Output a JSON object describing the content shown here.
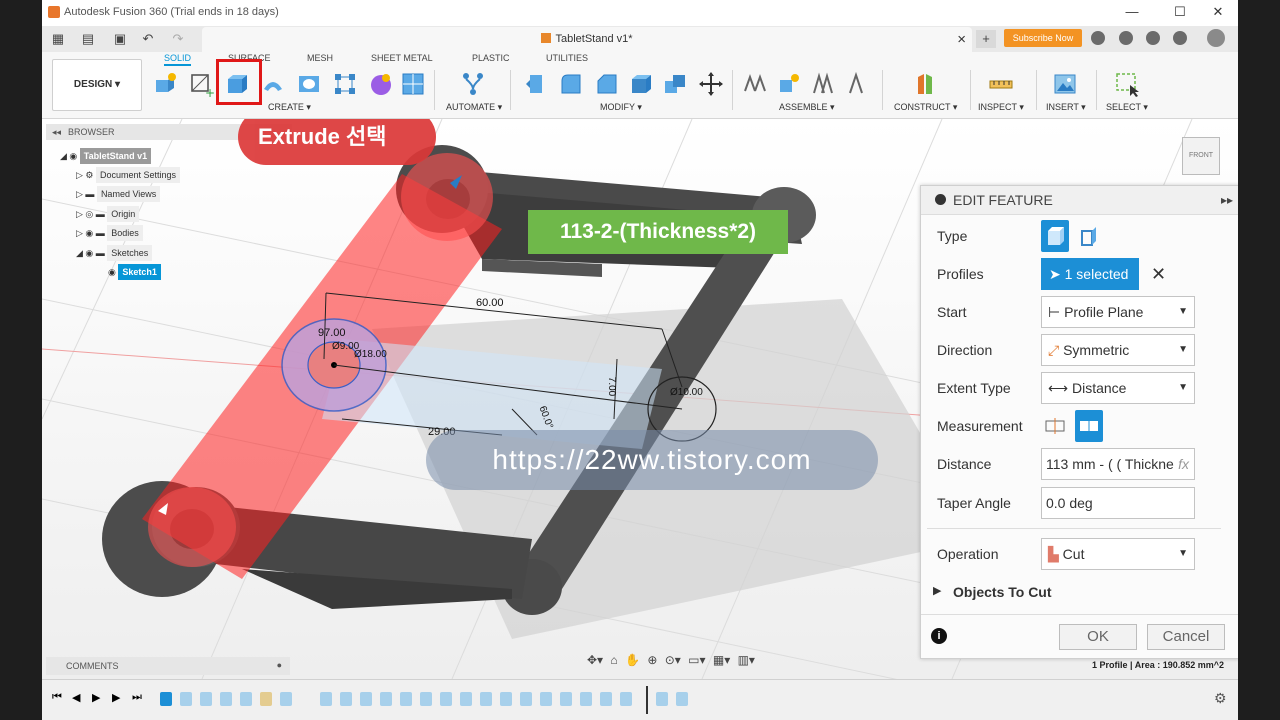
{
  "window": {
    "title": "Autodesk Fusion 360 (Trial ends in 18 days)",
    "minimize": "—",
    "maximize": "☐",
    "close": "✕"
  },
  "tabbar": {
    "doc_tab": "TabletStand v1*",
    "doc_close": "×",
    "new_tab": "+",
    "subscribe": "Subscribe Now"
  },
  "toolbar": {
    "workspace": "DESIGN ▾",
    "tabs": [
      "SOLID",
      "SURFACE",
      "MESH",
      "SHEET METAL",
      "PLASTIC",
      "UTILITIES"
    ],
    "groups": [
      "CREATE ▾",
      "AUTOMATE ▾",
      "MODIFY ▾",
      "ASSEMBLE ▾",
      "CONSTRUCT ▾",
      "INSPECT ▾",
      "INSERT ▾",
      "SELECT ▾"
    ]
  },
  "browser": {
    "title": "BROWSER",
    "items": [
      "TabletStand v1",
      "Document Settings",
      "Named Views",
      "Origin",
      "Bodies",
      "Sketches",
      "Sketch1"
    ]
  },
  "annotations": {
    "extrude": "Extrude 선택",
    "formula": "113-2-(Thickness*2)",
    "watermark": "https://22ww.tistory.com"
  },
  "dimensions": [
    "60.00",
    "97.00",
    "Ø9.00",
    "Ø18.00",
    "7.00",
    "29.00",
    "60.0°",
    "Ø10.00"
  ],
  "edit_feature": {
    "title": "EDIT FEATURE",
    "rows": {
      "type": "Type",
      "profiles": "Profiles",
      "start": "Start",
      "direction": "Direction",
      "extent_type": "Extent Type",
      "measurement": "Measurement",
      "distance": "Distance",
      "taper_angle": "Taper Angle",
      "operation": "Operation"
    },
    "values": {
      "profiles": "1 selected",
      "start": "Profile Plane",
      "direction": "Symmetric",
      "extent_type": "Distance",
      "distance": "113 mm - ( ( Thickne",
      "distance_fx": "fx",
      "taper_angle": "0.0 deg",
      "operation": "Cut"
    },
    "objects_to_cut": "Objects To Cut",
    "ok": "OK",
    "cancel": "Cancel"
  },
  "comments": "COMMENTS",
  "status": "1 Profile | Area : 190.852 mm^2",
  "viewcube": "FRONT",
  "colors": {
    "accent": "#0696d7",
    "annotation_red": "#dc3838",
    "annotation_green": "#6fb84a",
    "subscribe": "#f39323"
  }
}
